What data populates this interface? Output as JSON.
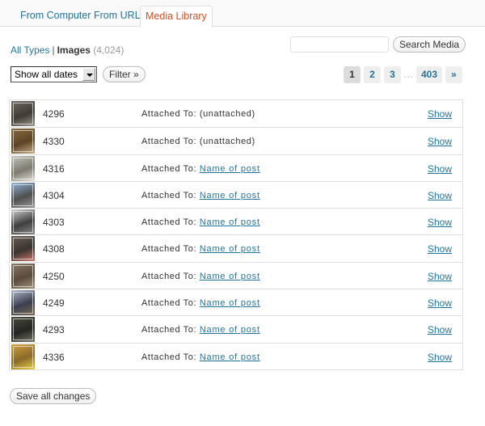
{
  "tabs": [
    {
      "label": "From Computer",
      "active": false
    },
    {
      "label": "From URL",
      "active": false
    },
    {
      "label": "Media Library",
      "active": true
    }
  ],
  "type_filter": {
    "all_types": "All Types",
    "separator": "|",
    "images": "Images",
    "images_count": "(4,024)"
  },
  "search": {
    "value": "",
    "placeholder": "",
    "button": "Search Media"
  },
  "date_filter": {
    "selected": "Show all dates",
    "button": "Filter »"
  },
  "pagination": {
    "pages": [
      "1",
      "2",
      "3"
    ],
    "current": "1",
    "ellipsis": "…",
    "last": "403",
    "next": "»"
  },
  "attached_label": "Attached To:",
  "show_label": "Show",
  "media_items": [
    {
      "id": "4296",
      "attached": "(unattached)",
      "linked": false,
      "thumb": [
        "#6f6a60",
        "#3e3b35",
        "#9b968a"
      ]
    },
    {
      "id": "4330",
      "attached": "(unattached)",
      "linked": false,
      "thumb": [
        "#8a6a3e",
        "#5b4426",
        "#c9b08a"
      ]
    },
    {
      "id": "4316",
      "attached": "Name of post",
      "linked": true,
      "thumb": [
        "#c8c6bd",
        "#7d7a70",
        "#e3e1da"
      ]
    },
    {
      "id": "4304",
      "attached": "Name of post",
      "linked": true,
      "thumb": [
        "#8fb4d6",
        "#4f4f4f",
        "#9a9a9a"
      ]
    },
    {
      "id": "4303",
      "attached": "Name of post",
      "linked": true,
      "thumb": [
        "#d2d2d2",
        "#3f3f3f",
        "#8a8a8a"
      ]
    },
    {
      "id": "4308",
      "attached": "Name of post",
      "linked": true,
      "thumb": [
        "#6b5d52",
        "#3a3430",
        "#d07a6a"
      ]
    },
    {
      "id": "4250",
      "attached": "Name of post",
      "linked": true,
      "thumb": [
        "#8a7a66",
        "#5a4a3a",
        "#a5957d"
      ]
    },
    {
      "id": "4249",
      "attached": "Name of post",
      "linked": true,
      "thumb": [
        "#b0b8c8",
        "#3a3f4f",
        "#7a6a52"
      ]
    },
    {
      "id": "4293",
      "attached": "Name of post",
      "linked": true,
      "thumb": [
        "#4a4a42",
        "#252520",
        "#7a7a6a"
      ]
    },
    {
      "id": "4336",
      "attached": "Name of post",
      "linked": true,
      "thumb": [
        "#d0a040",
        "#8a6a2a",
        "#e8d040"
      ]
    }
  ],
  "footer": {
    "save_button": "Save all changes"
  }
}
